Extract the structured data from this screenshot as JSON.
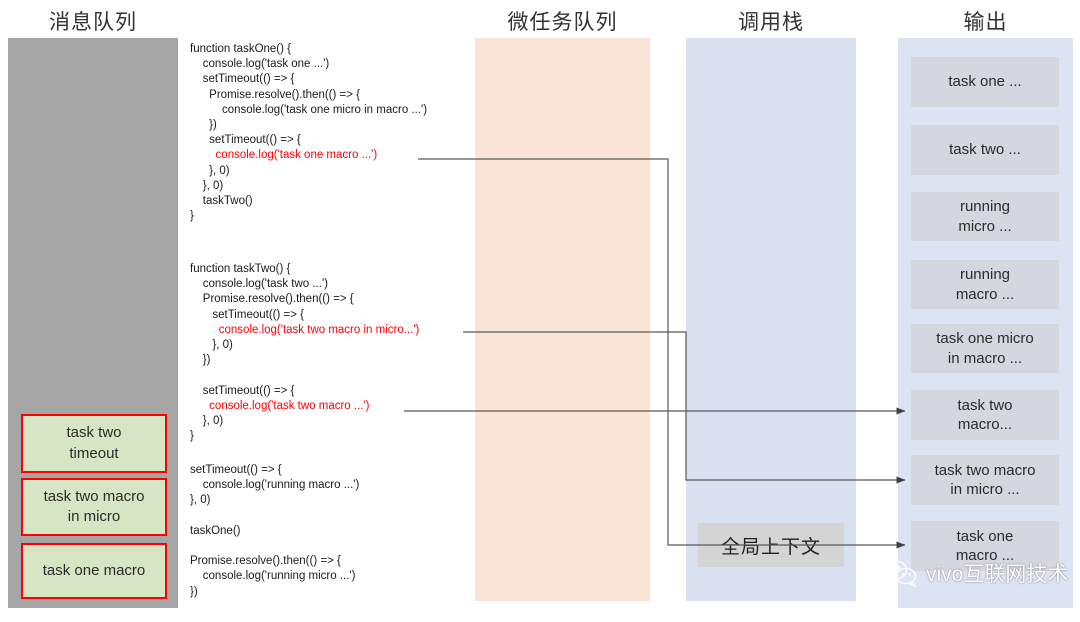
{
  "columns": {
    "message_queue_title": "消息队列",
    "microtask_queue_title": "微任务队列",
    "call_stack_title": "调用栈",
    "output_title": "输出"
  },
  "message_queue": {
    "items": [
      {
        "label": "task two\ntimeout"
      },
      {
        "label": "task two macro\nin micro"
      },
      {
        "label": "task one macro"
      }
    ]
  },
  "call_stack": {
    "frames": [
      {
        "label": "全局上下文"
      }
    ]
  },
  "output": {
    "items": [
      {
        "label": "task one ..."
      },
      {
        "label": "task two ..."
      },
      {
        "label": "running\nmicro ..."
      },
      {
        "label": "running\nmacro ..."
      },
      {
        "label": "task one micro\nin macro ..."
      },
      {
        "label": "task two\nmacro..."
      },
      {
        "label": "task two macro\nin micro ..."
      },
      {
        "label": "task one\nmacro ..."
      }
    ]
  },
  "code": {
    "highlight_color": "#FF0000",
    "block_one": [
      {
        "text": "function taskOne() {",
        "hl": false
      },
      {
        "text": "    console.log('task one ...')",
        "hl": false
      },
      {
        "text": "    setTimeout(() => {",
        "hl": false
      },
      {
        "text": "      Promise.resolve().then(() => {",
        "hl": false
      },
      {
        "text": "          console.log('task one micro in macro ...')",
        "hl": false
      },
      {
        "text": "      })",
        "hl": false
      },
      {
        "text": "      setTimeout(() => {",
        "hl": false
      },
      {
        "text": "        console.log('task one macro ...')",
        "hl": true
      },
      {
        "text": "      }, 0)",
        "hl": false
      },
      {
        "text": "    }, 0)",
        "hl": false
      },
      {
        "text": "    taskTwo()",
        "hl": false
      },
      {
        "text": "}",
        "hl": false
      }
    ],
    "block_two": [
      {
        "text": "function taskTwo() {",
        "hl": false
      },
      {
        "text": "    console.log('task two ...')",
        "hl": false
      },
      {
        "text": "    Promise.resolve().then(() => {",
        "hl": false
      },
      {
        "text": "       setTimeout(() => {",
        "hl": false
      },
      {
        "text": "         console.log('task two macro in micro...')",
        "hl": true
      },
      {
        "text": "       }, 0)",
        "hl": false
      },
      {
        "text": "    })",
        "hl": false
      },
      {
        "text": "",
        "hl": false
      },
      {
        "text": "    setTimeout(() => {",
        "hl": false
      },
      {
        "text": "      console.log('task two macro ...')",
        "hl": true
      },
      {
        "text": "    }, 0)",
        "hl": false
      },
      {
        "text": "}",
        "hl": false
      }
    ],
    "block_three": [
      {
        "text": "setTimeout(() => {",
        "hl": false
      },
      {
        "text": "    console.log('running macro ...')",
        "hl": false
      },
      {
        "text": "}, 0)",
        "hl": false
      },
      {
        "text": "",
        "hl": false
      },
      {
        "text": "taskOne()",
        "hl": false
      },
      {
        "text": "",
        "hl": false
      },
      {
        "text": "Promise.resolve().then(() => {",
        "hl": false
      },
      {
        "text": "    console.log('running micro ...')",
        "hl": false
      },
      {
        "text": "})",
        "hl": false
      }
    ]
  },
  "watermark": {
    "text": "vivo互联网技术"
  },
  "colors": {
    "message_queue_panel": "#A6A6A6",
    "microtask_panel": "#FAE4D7",
    "call_stack_panel": "#D9E1F1",
    "output_panel": "#DCE3F2",
    "queue_item_fill": "#D6E5C3",
    "queue_item_border": "#FF0000",
    "output_item_fill": "#D4D7DE",
    "stack_frame_fill": "#D4D4D4",
    "connector": "#595959"
  }
}
